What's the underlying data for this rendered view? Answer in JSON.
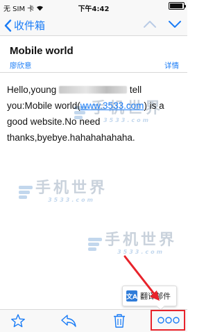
{
  "status_bar": {
    "carrier": "无 SIM 卡",
    "time": "下午4:42",
    "battery_level": 0.95
  },
  "nav": {
    "back_label": "收件箱"
  },
  "mail": {
    "subject": "Mobile world",
    "sender": "廖欣意",
    "details_label": "详情",
    "body": {
      "part1": "Hello,young",
      "part2": "tell you:Mobile world(",
      "link": "www.3533.com",
      "part3": ") is a good website.No need thanks,byebye.hahahahahaha."
    }
  },
  "watermark": {
    "text_cn": "手机世界",
    "text_num": "3533.com"
  },
  "translate_popup": {
    "label": "翻译邮件",
    "icon_char": "文A"
  },
  "toolbar": {
    "buttons": [
      "star-icon",
      "reply-icon",
      "trash-icon",
      "more-icon"
    ]
  },
  "colors": {
    "accent": "#1a7cf6",
    "highlight": "#e8232b",
    "bar_bg": "#f8f8f8"
  }
}
